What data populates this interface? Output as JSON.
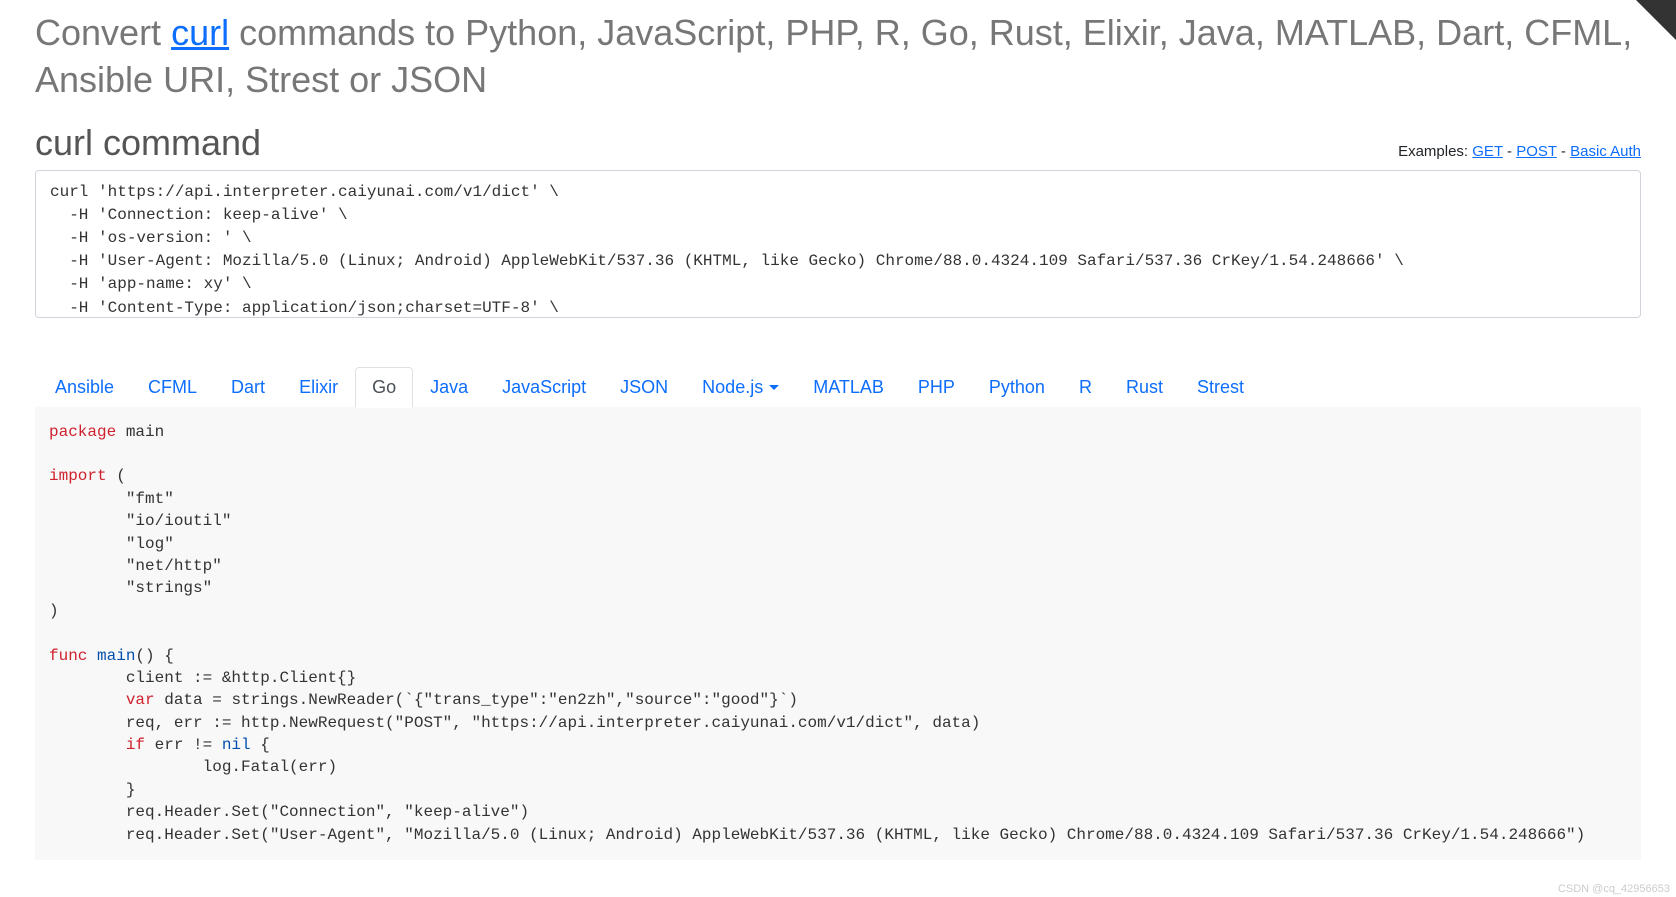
{
  "heading": {
    "pre": "Convert ",
    "link": "curl",
    "post": " commands to Python, JavaScript, PHP, R, Go, Rust, Elixir, Java, MATLAB, Dart, CFML, Ansible URI, Strest or JSON"
  },
  "section_title": "curl command",
  "examples": {
    "label": "Examples: ",
    "get": "GET",
    "post": "POST",
    "basic": "Basic Auth"
  },
  "curl_text": "curl 'https://api.interpreter.caiyunai.com/v1/dict' \\\n  -H 'Connection: keep-alive' \\\n  -H 'os-version: ' \\\n  -H 'User-Agent: Mozilla/5.0 (Linux; Android) AppleWebKit/537.36 (KHTML, like Gecko) Chrome/88.0.4324.109 Safari/537.36 CrKey/1.54.248666' \\\n  -H 'app-name: xy' \\\n  -H 'Content-Type: application/json;charset=UTF-8' \\",
  "tabs": [
    "Ansible",
    "CFML",
    "Dart",
    "Elixir",
    "Go",
    "Java",
    "JavaScript",
    "JSON",
    "Node.js",
    "MATLAB",
    "PHP",
    "Python",
    "R",
    "Rust",
    "Strest"
  ],
  "active_tab": "Go",
  "code": {
    "l1a": "package",
    "l1b": " main",
    "l2a": "import",
    "l2b": " (",
    "l3": "        \"fmt\"",
    "l4": "        \"io/ioutil\"",
    "l5": "        \"log\"",
    "l6": "        \"net/http\"",
    "l7": "        \"strings\"",
    "l8": ")",
    "l9a": "func",
    "l9b": " ",
    "l9c": "main",
    "l9d": "() {",
    "l10": "        client := &http.Client{}",
    "l11a": "        ",
    "l11b": "var",
    "l11c": " data = strings.NewReader(`{\"trans_type\":\"en2zh\",\"source\":\"good\"}`)",
    "l12": "        req, err := http.NewRequest(\"POST\", \"https://api.interpreter.caiyunai.com/v1/dict\", data)",
    "l13a": "        ",
    "l13b": "if",
    "l13c": " err != ",
    "l13d": "nil",
    "l13e": " {",
    "l14": "                log.Fatal(err)",
    "l15": "        }",
    "l16": "        req.Header.Set(\"Connection\", \"keep-alive\")",
    "l17": "        req.Header.Set(\"User-Agent\", \"Mozilla/5.0 (Linux; Android) AppleWebKit/537.36 (KHTML, like Gecko) Chrome/88.0.4324.109 Safari/537.36 CrKey/1.54.248666\")"
  },
  "watermark": "CSDN @cq_42956653"
}
